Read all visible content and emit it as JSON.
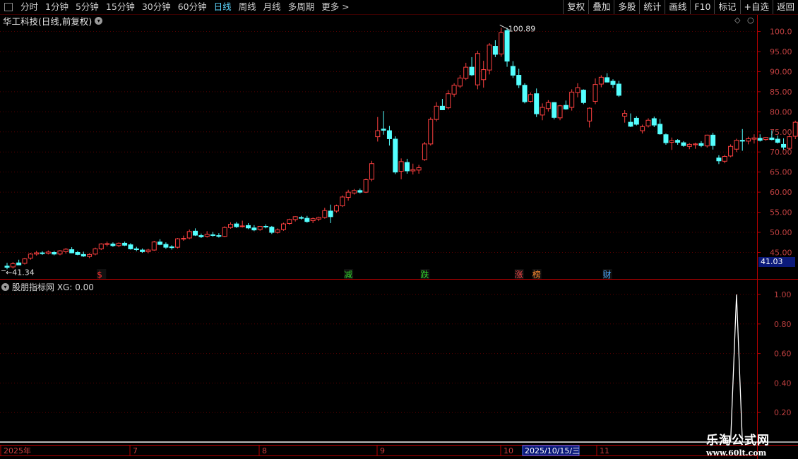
{
  "toolbar": {
    "periods": [
      "分时",
      "1分钟",
      "5分钟",
      "15分钟",
      "30分钟",
      "60分钟",
      "日线",
      "周线",
      "月线",
      "多周期",
      "更多 >"
    ],
    "active_period": "日线",
    "right_buttons": [
      "复权",
      "叠加",
      "多股",
      "统计",
      "画线",
      "F10",
      "标记",
      "+自选",
      "返回"
    ]
  },
  "chart_title": "华工科技(日线,前复权)",
  "indicator_title": "股朋指标网 XG: 0.00",
  "last_price_box": "41.03",
  "max_label": "100.89",
  "min_label": "41.34",
  "date_labels": [
    "2025年",
    "7",
    "8",
    "9",
    "10",
    "2025/10/15/三",
    "11"
  ],
  "watermark": {
    "line1": "乐淘公式网",
    "line2": "www.60lt.com"
  },
  "colors": {
    "up": "#ff4040",
    "down": "#54ffff",
    "axis": "#b40000",
    "grid": "#5a0000",
    "up_fill": "#000000"
  },
  "chart_data": [
    {
      "type": "candlestick",
      "title": "华工科技(日线,前复权)",
      "yticks": [
        "100.0",
        "95.00",
        "90.00",
        "85.00",
        "80.00",
        "75.00",
        "70.00",
        "65.00",
        "60.00",
        "55.00",
        "50.00",
        "45.00"
      ],
      "ylim": [
        41.0,
        102.0
      ],
      "candles": [
        [
          41.6,
          42.4,
          40.8,
          41.3
        ],
        [
          41.4,
          42.6,
          41.0,
          42.2
        ],
        [
          42.4,
          43.2,
          41.9,
          41.9
        ],
        [
          42.3,
          43.6,
          42.0,
          43.4
        ],
        [
          43.6,
          44.9,
          43.2,
          44.6
        ],
        [
          44.6,
          45.4,
          44.2,
          44.9
        ],
        [
          44.9,
          45.3,
          44.4,
          44.7
        ],
        [
          44.8,
          45.5,
          44.5,
          45.1
        ],
        [
          45.0,
          45.4,
          44.3,
          44.6
        ],
        [
          44.6,
          45.6,
          44.3,
          45.4
        ],
        [
          45.2,
          46.1,
          44.7,
          45.8
        ],
        [
          45.7,
          46.3,
          44.8,
          44.9
        ],
        [
          45.0,
          45.4,
          44.3,
          44.5
        ],
        [
          44.5,
          45.2,
          43.9,
          44.1
        ],
        [
          44.0,
          44.8,
          43.6,
          44.5
        ],
        [
          44.6,
          46.2,
          44.3,
          45.9
        ],
        [
          45.9,
          47.3,
          45.6,
          47.1
        ],
        [
          47.0,
          47.7,
          46.5,
          47.2
        ],
        [
          47.1,
          47.5,
          46.4,
          46.7
        ],
        [
          46.7,
          47.5,
          46.3,
          47.3
        ],
        [
          47.3,
          47.7,
          46.6,
          46.8
        ],
        [
          46.9,
          47.3,
          45.7,
          45.9
        ],
        [
          45.9,
          46.4,
          45.3,
          45.7
        ],
        [
          45.6,
          46.0,
          44.9,
          45.2
        ],
        [
          45.2,
          45.9,
          44.8,
          45.6
        ],
        [
          45.6,
          47.9,
          45.4,
          47.6
        ],
        [
          47.6,
          48.3,
          46.8,
          47.0
        ],
        [
          47.0,
          47.5,
          45.9,
          46.3
        ],
        [
          46.4,
          46.8,
          45.7,
          46.2
        ],
        [
          46.3,
          48.6,
          46.0,
          48.4
        ],
        [
          48.4,
          49.2,
          47.9,
          48.5
        ],
        [
          48.6,
          50.7,
          48.3,
          50.2
        ],
        [
          50.3,
          51.0,
          49.1,
          49.3
        ],
        [
          49.2,
          49.7,
          48.6,
          48.9
        ],
        [
          49.0,
          50.3,
          48.7,
          49.5
        ],
        [
          49.4,
          50.1,
          48.9,
          49.3
        ],
        [
          49.2,
          49.8,
          48.7,
          49.0
        ],
        [
          49.0,
          51.5,
          48.8,
          51.2
        ],
        [
          51.2,
          52.5,
          50.9,
          52.0
        ],
        [
          52.1,
          52.6,
          51.1,
          51.4
        ],
        [
          51.5,
          52.9,
          51.2,
          51.6
        ],
        [
          51.7,
          52.3,
          50.8,
          51.1
        ],
        [
          51.1,
          51.8,
          50.3,
          50.6
        ],
        [
          50.7,
          51.6,
          50.4,
          51.5
        ],
        [
          51.5,
          52.0,
          51.0,
          51.4
        ],
        [
          51.3,
          51.6,
          49.6,
          50.0
        ],
        [
          50.0,
          51.0,
          49.7,
          50.6
        ],
        [
          50.7,
          52.4,
          50.4,
          52.1
        ],
        [
          52.2,
          53.4,
          51.9,
          53.2
        ],
        [
          53.2,
          54.0,
          52.7,
          53.9
        ],
        [
          53.7,
          54.1,
          53.2,
          53.5
        ],
        [
          53.5,
          54.1,
          52.4,
          52.7
        ],
        [
          52.9,
          53.7,
          52.3,
          53.4
        ],
        [
          53.3,
          53.9,
          52.8,
          53.7
        ],
        [
          53.7,
          56.1,
          53.4,
          55.4
        ],
        [
          55.3,
          56.9,
          52.3,
          53.9
        ],
        [
          55.3,
          56.9,
          54.9,
          56.6
        ],
        [
          56.6,
          59.2,
          56.3,
          58.8
        ],
        [
          58.7,
          60.6,
          57.9,
          60.0
        ],
        [
          59.8,
          60.8,
          59.4,
          60.4
        ],
        [
          60.4,
          60.9,
          59.7,
          60.0
        ],
        [
          60.0,
          63.4,
          59.8,
          63.1
        ],
        [
          63.2,
          67.8,
          62.7,
          67.1
        ],
        [
          73.8,
          78.7,
          72.6,
          75.3
        ],
        [
          75.7,
          80.2,
          74.3,
          75.4
        ],
        [
          75.3,
          76.5,
          71.6,
          73.3
        ],
        [
          73.2,
          73.9,
          64.5,
          65.0
        ],
        [
          65.2,
          68.4,
          63.2,
          67.6
        ],
        [
          67.4,
          68.3,
          64.6,
          65.3
        ],
        [
          65.3,
          67.1,
          64.4,
          65.6
        ],
        [
          65.5,
          66.8,
          64.6,
          66.1
        ],
        [
          68.1,
          72.5,
          67.8,
          72.0
        ],
        [
          72.0,
          78.6,
          71.6,
          78.1
        ],
        [
          78.1,
          82.4,
          77.6,
          81.4
        ],
        [
          81.4,
          83.2,
          80.7,
          80.5
        ],
        [
          81.0,
          85.4,
          80.6,
          84.5
        ],
        [
          84.4,
          87.1,
          83.7,
          86.6
        ],
        [
          86.4,
          89.2,
          85.9,
          88.4
        ],
        [
          88.3,
          92.2,
          87.9,
          91.1
        ],
        [
          91.1,
          93.6,
          88.9,
          89.2
        ],
        [
          86.7,
          95.2,
          85.6,
          94.5
        ],
        [
          88.0,
          92.7,
          86.0,
          90.5
        ],
        [
          90.4,
          97.1,
          89.3,
          96.6
        ],
        [
          96.3,
          97.8,
          93.6,
          94.3
        ],
        [
          94.4,
          100.9,
          93.7,
          99.7
        ],
        [
          100.2,
          100.9,
          91.2,
          92.6
        ],
        [
          91.3,
          92.6,
          88.4,
          89.1
        ],
        [
          89.1,
          90.7,
          85.9,
          86.7
        ],
        [
          86.6,
          87.1,
          82.1,
          82.5
        ],
        [
          82.6,
          84.8,
          82.3,
          84.3
        ],
        [
          84.5,
          85.8,
          78.7,
          79.5
        ],
        [
          79.2,
          82.1,
          77.9,
          81.1
        ],
        [
          80.8,
          82.9,
          80.1,
          82.3
        ],
        [
          82.3,
          82.4,
          78.1,
          78.6
        ],
        [
          78.5,
          81.7,
          77.9,
          81.5
        ],
        [
          81.6,
          82.8,
          80.5,
          80.7
        ],
        [
          81.1,
          85.6,
          80.3,
          84.9
        ],
        [
          84.8,
          87.1,
          83.6,
          86.0
        ],
        [
          85.4,
          85.6,
          81.9,
          82.3
        ],
        [
          77.7,
          81.1,
          76.1,
          80.9
        ],
        [
          82.6,
          88.3,
          81.9,
          86.8
        ],
        [
          86.9,
          89.1,
          86.1,
          88.6
        ],
        [
          88.5,
          89.6,
          87.3,
          87.4
        ],
        [
          87.6,
          88.1,
          85.9,
          86.8
        ],
        [
          86.9,
          87.7,
          83.7,
          84.1
        ],
        [
          78.9,
          80.4,
          77.3,
          79.6
        ],
        [
          77.4,
          79.6,
          76.2,
          76.4
        ],
        [
          78.4,
          78.9,
          76.6,
          76.9
        ],
        [
          75.3,
          76.8,
          74.6,
          76.3
        ],
        [
          76.5,
          78.4,
          76.1,
          77.9
        ],
        [
          78.3,
          78.8,
          76.2,
          76.7
        ],
        [
          76.9,
          78.2,
          74.3,
          74.5
        ],
        [
          74.3,
          74.6,
          71.8,
          72.3
        ],
        [
          72.4,
          73.6,
          70.5,
          72.8
        ],
        [
          72.9,
          73.2,
          71.8,
          72.4
        ],
        [
          72.3,
          72.7,
          71.3,
          71.6
        ],
        [
          71.4,
          72.2,
          70.7,
          71.9
        ],
        [
          71.8,
          72.3,
          70.8,
          72.0
        ],
        [
          72.1,
          72.7,
          71.2,
          71.6
        ],
        [
          71.5,
          74.3,
          71.1,
          74.2
        ],
        [
          74.2,
          74.8,
          70.6,
          71.6
        ],
        [
          68.5,
          69.2,
          67.0,
          67.8
        ],
        [
          67.7,
          69.3,
          67.2,
          68.9
        ],
        [
          69.0,
          71.9,
          68.7,
          71.4
        ],
        [
          70.7,
          73.3,
          70.0,
          72.9
        ],
        [
          72.9,
          75.7,
          70.3,
          72.7
        ],
        [
          72.7,
          73.8,
          71.9,
          73.3
        ],
        [
          73.2,
          74.4,
          72.1,
          73.5
        ],
        [
          73.4,
          74.4,
          72.6,
          72.9
        ],
        [
          73.1,
          73.7,
          72.8,
          73.6
        ],
        [
          73.5,
          75.4,
          72.9,
          73.1
        ],
        [
          73.2,
          74.1,
          72.1,
          72.4
        ],
        [
          71.9,
          73.4,
          70.6,
          71.2
        ],
        [
          70.9,
          74.2,
          70.5,
          73.8
        ],
        [
          73.9,
          77.8,
          73.2,
          77.4
        ],
        [
          77.2,
          82.3,
          76.8,
          81.0
        ]
      ],
      "signals": [
        {
          "index": 16,
          "text": "$",
          "color": "#ff3030"
        },
        {
          "index": 58,
          "text": "减",
          "color": "#31d02a"
        },
        {
          "index": 71,
          "text": "跌",
          "color": "#31d02a"
        },
        {
          "index": 87,
          "text": "涨",
          "color": "#ff4a4a"
        },
        {
          "index": 90,
          "text": "榜",
          "color": "#ff8a30"
        },
        {
          "index": 102,
          "text": "财",
          "color": "#4aa8ff"
        }
      ]
    },
    {
      "type": "line",
      "title": "股朋指标网 XG: 0.00",
      "yticks": [
        "1.00",
        "0.80",
        "0.60",
        "0.40",
        "0.20"
      ],
      "ylim": [
        0,
        1.05
      ],
      "spike_index": 124,
      "values_nonzero": [
        {
          "index": 124,
          "value": 1.0
        }
      ]
    }
  ]
}
